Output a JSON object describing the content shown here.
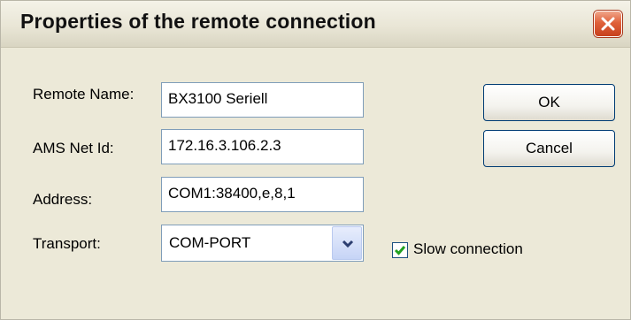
{
  "window": {
    "title": "Properties of the remote connection"
  },
  "fields": {
    "remote_name_label": "Remote Name:",
    "remote_name_value": "BX3100 Seriell",
    "ams_net_id_label": "AMS Net Id:",
    "ams_net_id_value": "172.16.3.106.2.3",
    "address_label": "Address:",
    "address_value": "COM1:38400,e,8,1",
    "transport_label": "Transport:",
    "transport_value": "COM-PORT"
  },
  "options": {
    "slow_connection_label": "Slow connection",
    "slow_connection_checked": true
  },
  "buttons": {
    "ok": "OK",
    "cancel": "Cancel"
  },
  "icons": {
    "close": "close-icon",
    "dropdown": "chevron-down-icon",
    "check": "check-icon"
  },
  "colors": {
    "close_button": "#d9532f",
    "checkmark": "#21a121",
    "field_border": "#7f9db9",
    "dialog_background": "#ece9d8"
  }
}
